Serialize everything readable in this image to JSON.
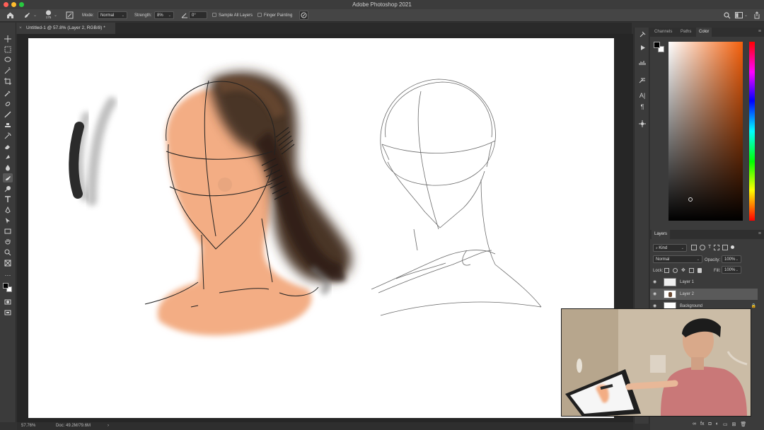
{
  "window": {
    "title": "Adobe Photoshop 2021"
  },
  "options_bar": {
    "brush_size": "175",
    "mode_label": "Mode:",
    "mode_value": "Normal",
    "strength_label": "Strength:",
    "strength_value": "8%",
    "angle_value": "0°",
    "sample_all_layers_label": "Sample All Layers",
    "finger_painting_label": "Finger Painting"
  },
  "document": {
    "tab_label": "Untitled-1 @ 57.8% (Layer 2, RGB/8) *"
  },
  "status": {
    "zoom": "57.76%",
    "doc_info": "Doc: 49.2M/79.6M"
  },
  "panels": {
    "color_tabs": [
      "Channels",
      "Paths",
      "Color"
    ],
    "active_color_tab": "Color",
    "color_picker": {
      "base_hue": "#f4600c",
      "foreground": "#000000",
      "background": "#ffffff"
    },
    "layers": {
      "title": "Layers",
      "filter_label": "Kind",
      "blend_mode": "Normal",
      "opacity_label": "Opacity:",
      "opacity_value": "100%",
      "lock_label": "Lock:",
      "fill_label": "Fill:",
      "fill_value": "100%",
      "items": [
        {
          "name": "Layer 1"
        },
        {
          "name": "Layer 2"
        },
        {
          "name": "Background"
        }
      ]
    }
  },
  "colors": {
    "skin": "#f3ad84",
    "hair": "#4a3526",
    "accent": "#f4600c"
  }
}
